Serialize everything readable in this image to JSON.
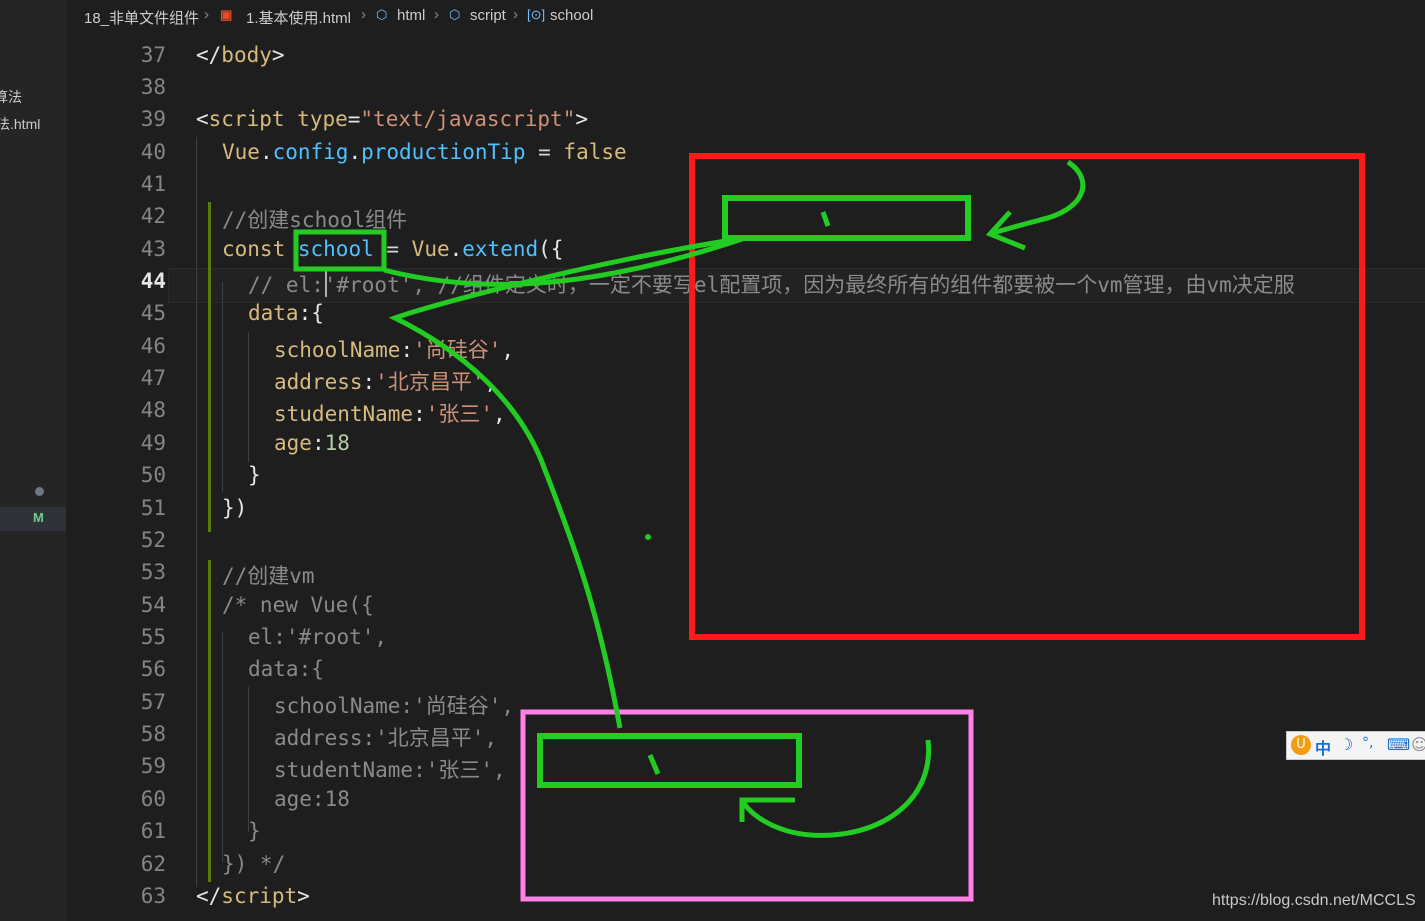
{
  "sidebar": {
    "files": [
      "算法",
      "法.html"
    ],
    "status_badge": "M"
  },
  "breadcrumb": {
    "items": [
      "18_非单文件组件",
      "1.基本使用.html",
      "html",
      "script",
      "school"
    ],
    "icons": [
      "html5-icon",
      "cube-icon",
      "cube-icon",
      "variable-icon"
    ]
  },
  "editor": {
    "active_line": "44",
    "line_numbers": [
      "37",
      "38",
      "39",
      "40",
      "41",
      "42",
      "43",
      "44",
      "45",
      "46",
      "47",
      "48",
      "49",
      "50",
      "51",
      "52",
      "53",
      "54",
      "55",
      "56",
      "57",
      "58",
      "59",
      "60",
      "61",
      "62",
      "63"
    ],
    "code": {
      "l37": {
        "open": "</",
        "tag": "body",
        "close": ">"
      },
      "l39": {
        "open": "<",
        "tag": "script",
        "attr": "type",
        "eq": "=",
        "val": "\"text/javascript\"",
        "close": ">"
      },
      "l40": {
        "obj": "Vue",
        "dot1": ".",
        "p1": "config",
        "dot2": ".",
        "p2": "productionTip",
        "op": " = ",
        "kw": "false"
      },
      "l42": {
        "comment": "//创建school组件"
      },
      "l43": {
        "kw": "const",
        "var": "school",
        "op": " = ",
        "obj": "Vue",
        "dot": ".",
        "fn": "extend",
        "punc": "({"
      },
      "l44": {
        "comment": "// el:'#root', //组件定义时，一定不要写el配置项，因为最终所有的组件都要被一个vm管理，由vm决定服"
      },
      "l45": {
        "prop": "data",
        "punc": ":{"
      },
      "l46": {
        "prop": "schoolName",
        "colon": ":",
        "val": "'尚硅谷'",
        "comma": ","
      },
      "l47": {
        "prop": "address",
        "colon": ":",
        "val": "'北京昌平'",
        "comma": ","
      },
      "l48": {
        "prop": "studentName",
        "colon": ":",
        "val": "'张三'",
        "comma": ","
      },
      "l49": {
        "prop": "age",
        "colon": ":",
        "num": "18"
      },
      "l50": {
        "punc": "}"
      },
      "l51": {
        "punc": "})"
      },
      "l53": {
        "comment": "//创建vm"
      },
      "l54": {
        "comment": "/* new Vue({"
      },
      "l55": {
        "comment": "el:'#root',"
      },
      "l56": {
        "comment": "data:{"
      },
      "l57": {
        "comment": "schoolName:'尚硅谷',"
      },
      "l58": {
        "comment": "address:'北京昌平',"
      },
      "l59": {
        "comment": "studentName:'张三',"
      },
      "l60": {
        "comment": "age:18"
      },
      "l61": {
        "comment": "}"
      },
      "l62": {
        "comment": "}) */"
      },
      "l63": {
        "open": "</",
        "tag": "script",
        "close": ">"
      }
    }
  },
  "annotation_colors": {
    "red_box": "#ff1a1a",
    "pink_box": "#ff80e6",
    "green_marker": "#22cc22"
  },
  "ime_toolbar": {
    "lang": "中",
    "moon": "☽",
    "punct": "°,",
    "keyboard": "⌨",
    "user": "☺"
  },
  "watermark": "https://blog.csdn.net/MCCLS"
}
